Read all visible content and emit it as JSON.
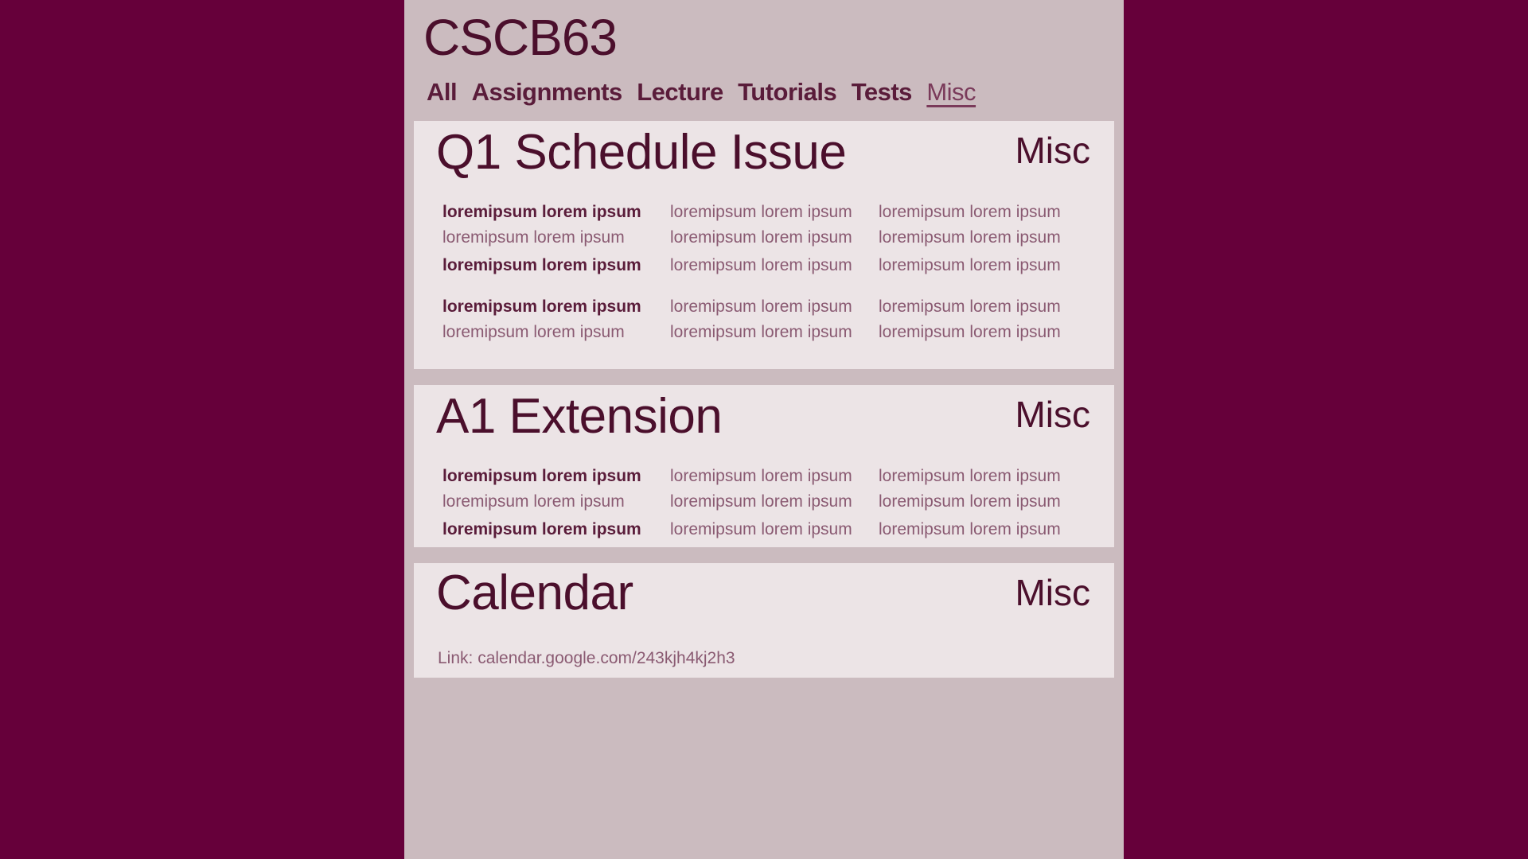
{
  "course": {
    "title": "CSCB63"
  },
  "tabs": [
    {
      "label": "All",
      "active": false
    },
    {
      "label": "Assignments",
      "active": false
    },
    {
      "label": "Lecture",
      "active": false
    },
    {
      "label": "Tutorials",
      "active": false
    },
    {
      "label": "Tests",
      "active": false
    },
    {
      "label": "Misc",
      "active": true
    }
  ],
  "cards": [
    {
      "title": "Q1 Schedule Issue",
      "tag": "Misc",
      "rows": [
        [
          "loremipsum lorem ipsum",
          "loremipsum lorem ipsum",
          "loremipsum lorem ipsum"
        ],
        [
          "loremipsum lorem ipsum",
          "loremipsum lorem ipsum",
          "loremipsum lorem ipsum"
        ],
        [
          "loremipsum lorem ipsum",
          "loremipsum lorem ipsum",
          "loremipsum lorem ipsum"
        ],
        [
          "loremipsum lorem ipsum",
          "loremipsum lorem ipsum",
          "loremipsum lorem ipsum"
        ],
        [
          "loremipsum lorem ipsum",
          "loremipsum lorem ipsum",
          "loremipsum lorem ipsum"
        ]
      ]
    },
    {
      "title": "A1 Extension",
      "tag": "Misc",
      "rows": [
        [
          "loremipsum lorem ipsum",
          "loremipsum lorem ipsum",
          "loremipsum lorem ipsum"
        ],
        [
          "loremipsum lorem ipsum",
          "loremipsum lorem ipsum",
          "loremipsum lorem ipsum"
        ],
        [
          "loremipsum lorem ipsum",
          "loremipsum lorem ipsum",
          "loremipsum lorem ipsum"
        ]
      ]
    },
    {
      "title": "Calendar",
      "tag": "Misc",
      "link": "Link: calendar.google.com/243kjh4kj2h3"
    }
  ],
  "colors": {
    "outer_background": "#66003a",
    "page_background": "#cbbbbf",
    "card_background": "#ece4e6",
    "text_dark": "#4b0f2c"
  }
}
